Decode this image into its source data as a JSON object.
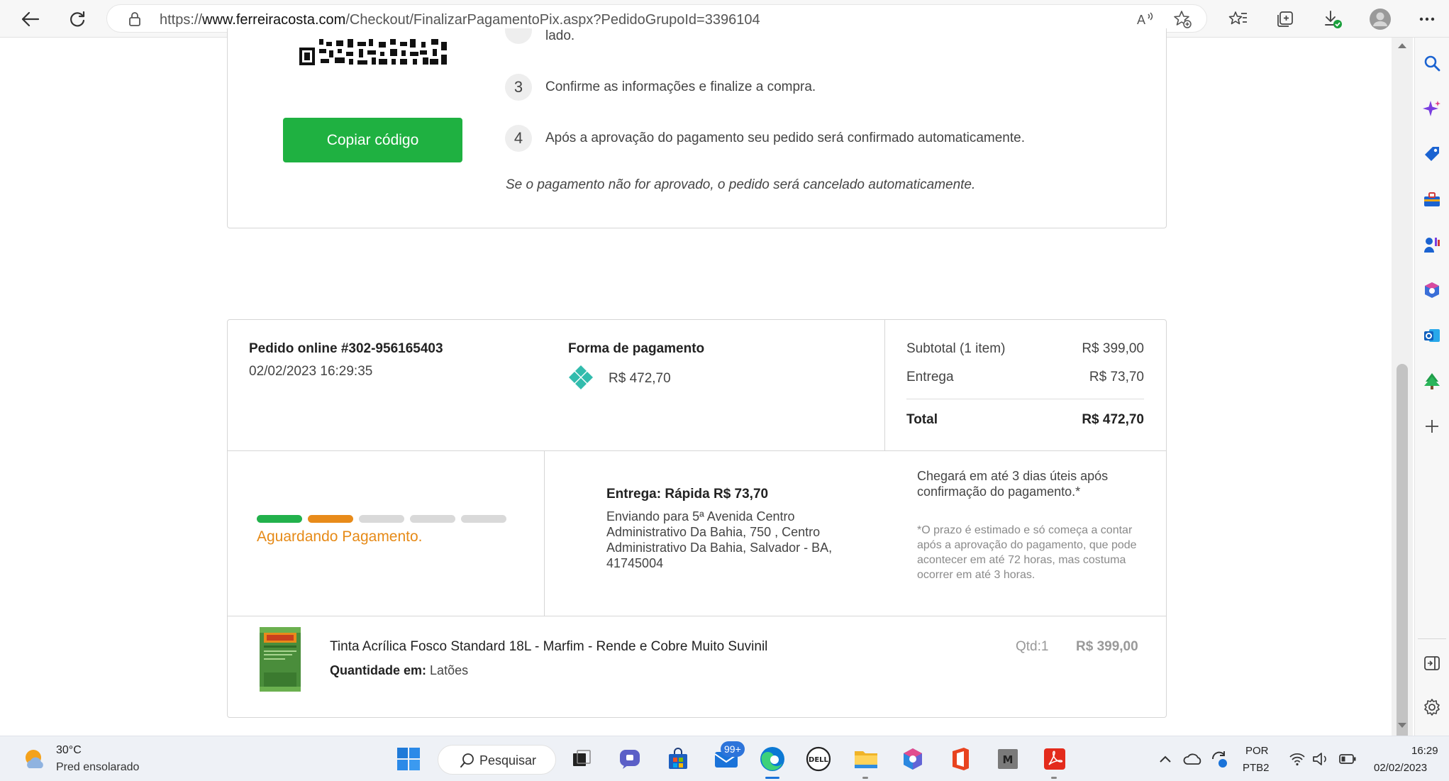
{
  "browser": {
    "url_prefix": "https://",
    "url_domain": "www.ferreiracosta.com",
    "url_path": "/Checkout/FinalizarPagamentoPix.aspx?PedidoGrupoId=3396104"
  },
  "instructions": {
    "partial_text": "lado.",
    "steps": [
      {
        "num": "3",
        "text": "Confirme as informações e finalize a compra."
      },
      {
        "num": "4",
        "text": "Após a aprovação do pagamento seu pedido será confirmado automaticamente."
      }
    ],
    "copy_button": "Copiar código",
    "cancel_note": "Se o pagamento não for aprovado, o pedido será cancelado automaticamente."
  },
  "order": {
    "number": "Pedido online #302-956165403",
    "date": "02/02/2023 16:29:35",
    "payment_title": "Forma de pagamento",
    "payment_amount": "R$ 472,70",
    "subtotal_label": "Subtotal (1 item)",
    "subtotal_value": "R$ 399,00",
    "delivery_label": "Entrega",
    "delivery_value": "R$ 73,70",
    "total_label": "Total",
    "total_value": "R$ 472,70"
  },
  "status": {
    "text": "Aguardando Pagamento.",
    "steps_completed": 2,
    "steps_total": 5,
    "colors": [
      "#22b14c",
      "#e88b1a",
      "#d9d9d9",
      "#d9d9d9",
      "#d9d9d9"
    ]
  },
  "delivery": {
    "title": "Entrega: Rápida R$ 73,70",
    "address": "Enviando para 5ª Avenida Centro Administrativo Da Bahia, 750 , Centro Administrativo Da Bahia, Salvador - BA, 41745004",
    "arrival": "Chegará em até 3 dias úteis após confirmação do pagamento.*",
    "note": "*O prazo é estimado e só começa a contar após a aprovação do pagamento, que pode acontecer em até 72 horas, mas costuma ocorrer em até 3 horas."
  },
  "product": {
    "name": "Tinta Acrílica Fosco Standard 18L - Marfim - Rende e Cobre Muito Suvinil",
    "qty_in_label": "Quantidade em:",
    "qty_in_value": "Latões",
    "qty": "Qtd:1",
    "price": "R$ 399,00"
  },
  "taskbar": {
    "weather_temp": "30°C",
    "weather_desc": "Pred ensolarado",
    "search_label": "Pesquisar",
    "mail_badge": "99+",
    "lang_top": "POR",
    "lang_bottom": "PTB2",
    "time": "16:29",
    "date": "02/02/2023"
  },
  "colors": {
    "accent_green": "#1fb141",
    "status_orange": "#e68a17",
    "pix_teal": "#32bcad"
  }
}
